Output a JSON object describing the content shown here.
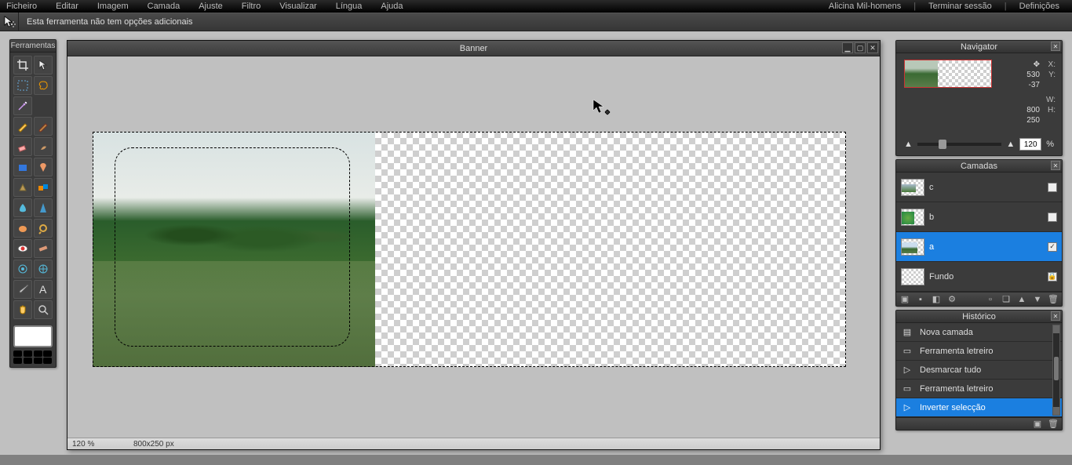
{
  "menu": {
    "items": [
      "Ficheiro",
      "Editar",
      "Imagem",
      "Camada",
      "Ajuste",
      "Filtro",
      "Visualizar",
      "Língua",
      "Ajuda"
    ],
    "user": "Alicina Mil-homens",
    "signout": "Terminar sessão",
    "settings": "Definições"
  },
  "options": {
    "text": "Esta ferramenta não tem opções adicionais"
  },
  "tools": {
    "title": "Ferramentas"
  },
  "document": {
    "title": "Banner",
    "zoom_status": "120 %",
    "dimensions_status": "800x250 px"
  },
  "navigator": {
    "title": "Navigator",
    "x_label": "X:",
    "x_val": "530",
    "y_label": "Y:",
    "y_val": "-37",
    "w_label": "W:",
    "w_val": "800",
    "h_label": "H:",
    "h_val": "250",
    "zoom": "120",
    "pct": "%"
  },
  "layers": {
    "title": "Camadas",
    "rows": [
      {
        "name": "c",
        "selected": false,
        "checked": false
      },
      {
        "name": "b",
        "selected": false,
        "checked": false
      },
      {
        "name": "a",
        "selected": true,
        "checked": true
      },
      {
        "name": "Fundo",
        "selected": false,
        "checked": false,
        "locked": true
      }
    ]
  },
  "history": {
    "title": "Histórico",
    "rows": [
      {
        "label": "Nova camada",
        "selected": false
      },
      {
        "label": "Ferramenta letreiro",
        "selected": false
      },
      {
        "label": "Desmarcar tudo",
        "selected": false
      },
      {
        "label": "Ferramenta letreiro",
        "selected": false
      },
      {
        "label": "Inverter selecção",
        "selected": true
      }
    ]
  }
}
